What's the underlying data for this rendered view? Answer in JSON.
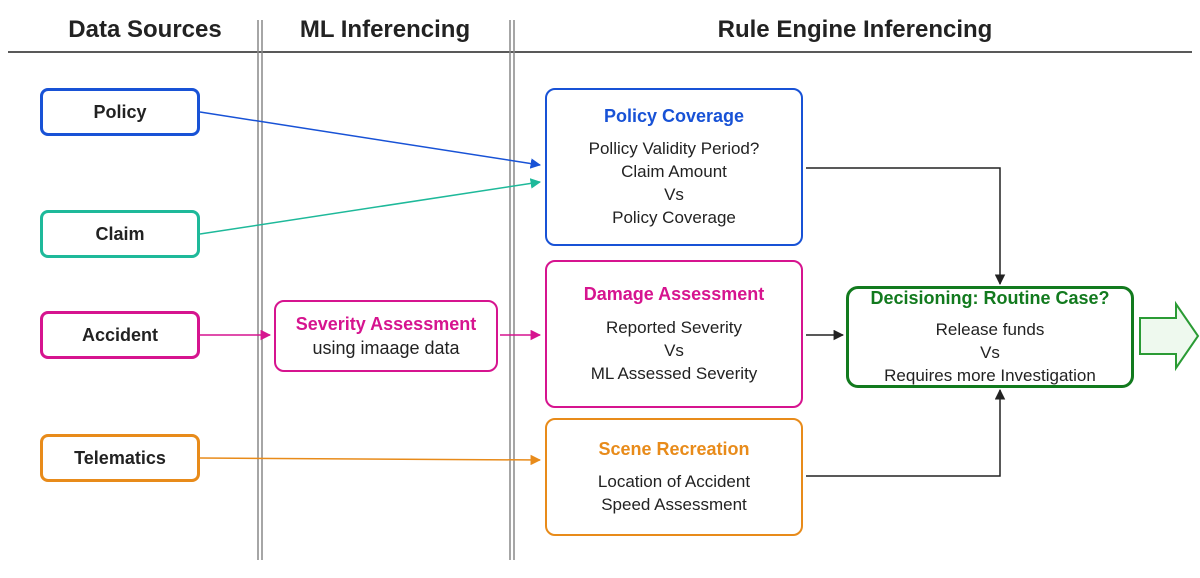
{
  "headers": {
    "col1": "Data Sources",
    "col2": "ML Inferencing",
    "col3": "Rule Engine Inferencing"
  },
  "sources": {
    "policy": {
      "label": "Policy",
      "color": "#1852d6"
    },
    "claim": {
      "label": "Claim",
      "color": "#1eb99a"
    },
    "accident": {
      "label": "Accident",
      "color": "#d6148f"
    },
    "telematics": {
      "label": "Telematics",
      "color": "#e88b1a"
    }
  },
  "ml": {
    "title": "Severity Assessment",
    "sub": "using imaage data"
  },
  "rules": {
    "coverage": {
      "title": "Policy Coverage",
      "line1": "Pollicy Validity Period?",
      "line2": "Claim Amount",
      "line3": "Vs",
      "line4": "Policy Coverage",
      "color": "#1852d6"
    },
    "damage": {
      "title": "Damage Assessment",
      "line1": "Reported Severity",
      "line2": "Vs",
      "line3": "ML Assessed Severity",
      "color": "#d6148f"
    },
    "scene": {
      "title": "Scene Recreation",
      "line1": "Location of Accident",
      "line2": "Speed Assessment",
      "color": "#e88b1a"
    }
  },
  "decision": {
    "title": "Decisioning: Routine Case?",
    "line1": "Release funds",
    "line2": "Vs",
    "line3": "Requires more Investigation"
  }
}
